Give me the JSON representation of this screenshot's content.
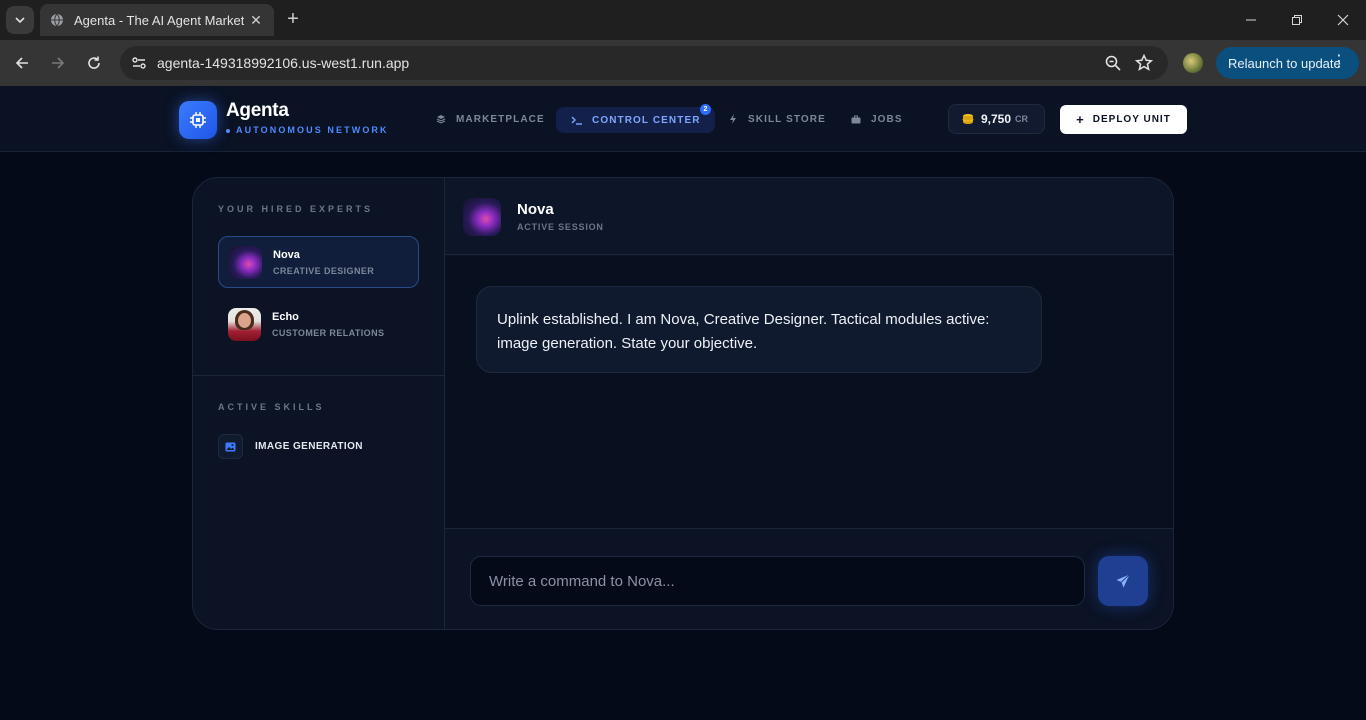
{
  "browser": {
    "tab_title": "Agenta - The AI Agent Marketplace",
    "url": "agenta-149318992106.us-west1.run.app",
    "relaunch_label": "Relaunch to update"
  },
  "header": {
    "brand": "Agenta",
    "tagline": "AUTONOMOUS NETWORK",
    "nav": [
      {
        "label": "MARKETPLACE",
        "icon": "layers-icon"
      },
      {
        "label": "CONTROL CENTER",
        "icon": "terminal-icon",
        "badge": "2"
      },
      {
        "label": "SKILL STORE",
        "icon": "bolt-icon"
      },
      {
        "label": "JOBS",
        "icon": "briefcase-icon"
      }
    ],
    "credits_amount": "9,750",
    "credits_unit": "CR",
    "deploy_label": "DEPLOY UNIT"
  },
  "sidebar": {
    "experts_title": "YOUR HIRED EXPERTS",
    "experts": [
      {
        "name": "Nova",
        "role": "CREATIVE DESIGNER",
        "active": true
      },
      {
        "name": "Echo",
        "role": "CUSTOMER RELATIONS",
        "active": false
      }
    ],
    "skills_title": "ACTIVE SKILLS",
    "skills": [
      {
        "label": "IMAGE GENERATION",
        "icon": "image-icon"
      }
    ]
  },
  "chat": {
    "agent_name": "Nova",
    "status": "ACTIVE SESSION",
    "messages": [
      {
        "text": "Uplink established. I am Nova, Creative Designer. Tactical modules active: image generation. State your objective."
      }
    ],
    "input_placeholder": "Write a command to Nova..."
  },
  "colors": {
    "accent": "#2e6bff",
    "background": "#050a18",
    "panel": "#0b1324"
  }
}
